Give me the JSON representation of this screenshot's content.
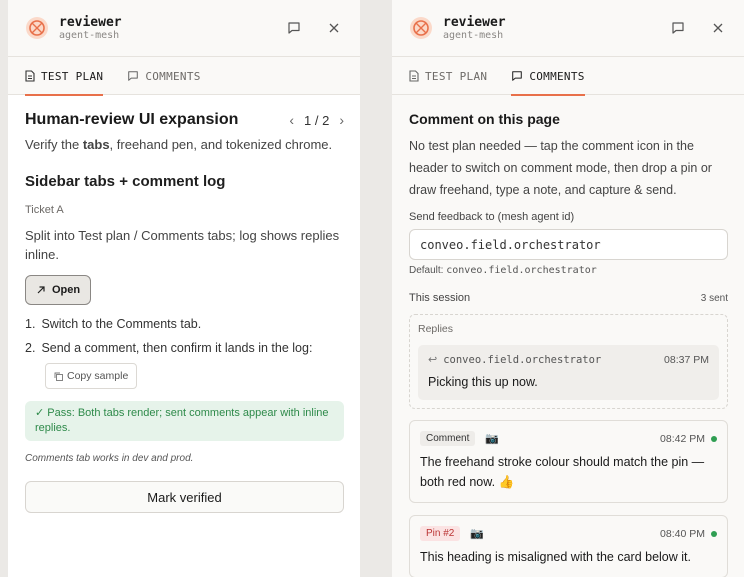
{
  "colors": {
    "accent": "#e8704a",
    "pass_bg": "#e6f3ea",
    "pass_text": "#2e8a4a",
    "status_dot": "#2f9e52",
    "pin_bg": "#fbe3e3"
  },
  "left": {
    "header": {
      "title": "reviewer",
      "subtitle": "agent-mesh"
    },
    "tabs": [
      {
        "label": "TEST PLAN",
        "icon": "document-icon"
      },
      {
        "label": "COMMENTS",
        "icon": "comment-icon"
      }
    ],
    "plan": {
      "title": "Human-review UI expansion",
      "pager": "1 / 2",
      "desc_before": "Verify the ",
      "desc_bold": "tabs",
      "desc_after": ", freehand pen, and tokenized chrome.",
      "section_title": "Sidebar tabs + comment log",
      "ticket": "Ticket A",
      "section_desc": "Split into Test plan / Comments tabs; log shows replies inline.",
      "open_label": "Open",
      "steps": [
        {
          "num": "1.",
          "text": "Switch to the Comments tab."
        },
        {
          "num": "2.",
          "text": "Send a comment, then confirm it lands in the log:"
        }
      ],
      "copy_label": "Copy sample",
      "pass_text": "✓ Pass: Both tabs render; sent comments appear with inline replies.",
      "note": "Comments tab works in dev and prod.",
      "verify_label": "Mark verified"
    }
  },
  "right": {
    "header": {
      "title": "reviewer",
      "subtitle": "agent-mesh"
    },
    "tabs": [
      {
        "label": "TEST PLAN",
        "icon": "document-icon"
      },
      {
        "label": "COMMENTS",
        "icon": "comment-icon"
      }
    ],
    "comments": {
      "title": "Comment on this page",
      "desc": "No test plan needed — tap the comment icon in the header to switch on comment mode, then drop a pin or draw freehand, type a note, and capture & send.",
      "send_label": "Send feedback to (mesh agent id)",
      "input_value": "conveo.field.orchestrator",
      "default_prefix": "Default: ",
      "default_value": "conveo.field.orchestrator",
      "session_label": "This session",
      "session_count": "3 sent",
      "replies_label": "Replies",
      "reply": {
        "from": "conveo.field.orchestrator",
        "time": "08:37 PM",
        "text": "Picking this up now."
      },
      "items": [
        {
          "tag": "Comment",
          "time": "08:42 PM",
          "text": "The freehand stroke colour should match the pin — both red now. 👍"
        },
        {
          "tag": "Pin #2",
          "time": "08:40 PM",
          "text": "This heading is misaligned with the card below it."
        }
      ]
    }
  }
}
